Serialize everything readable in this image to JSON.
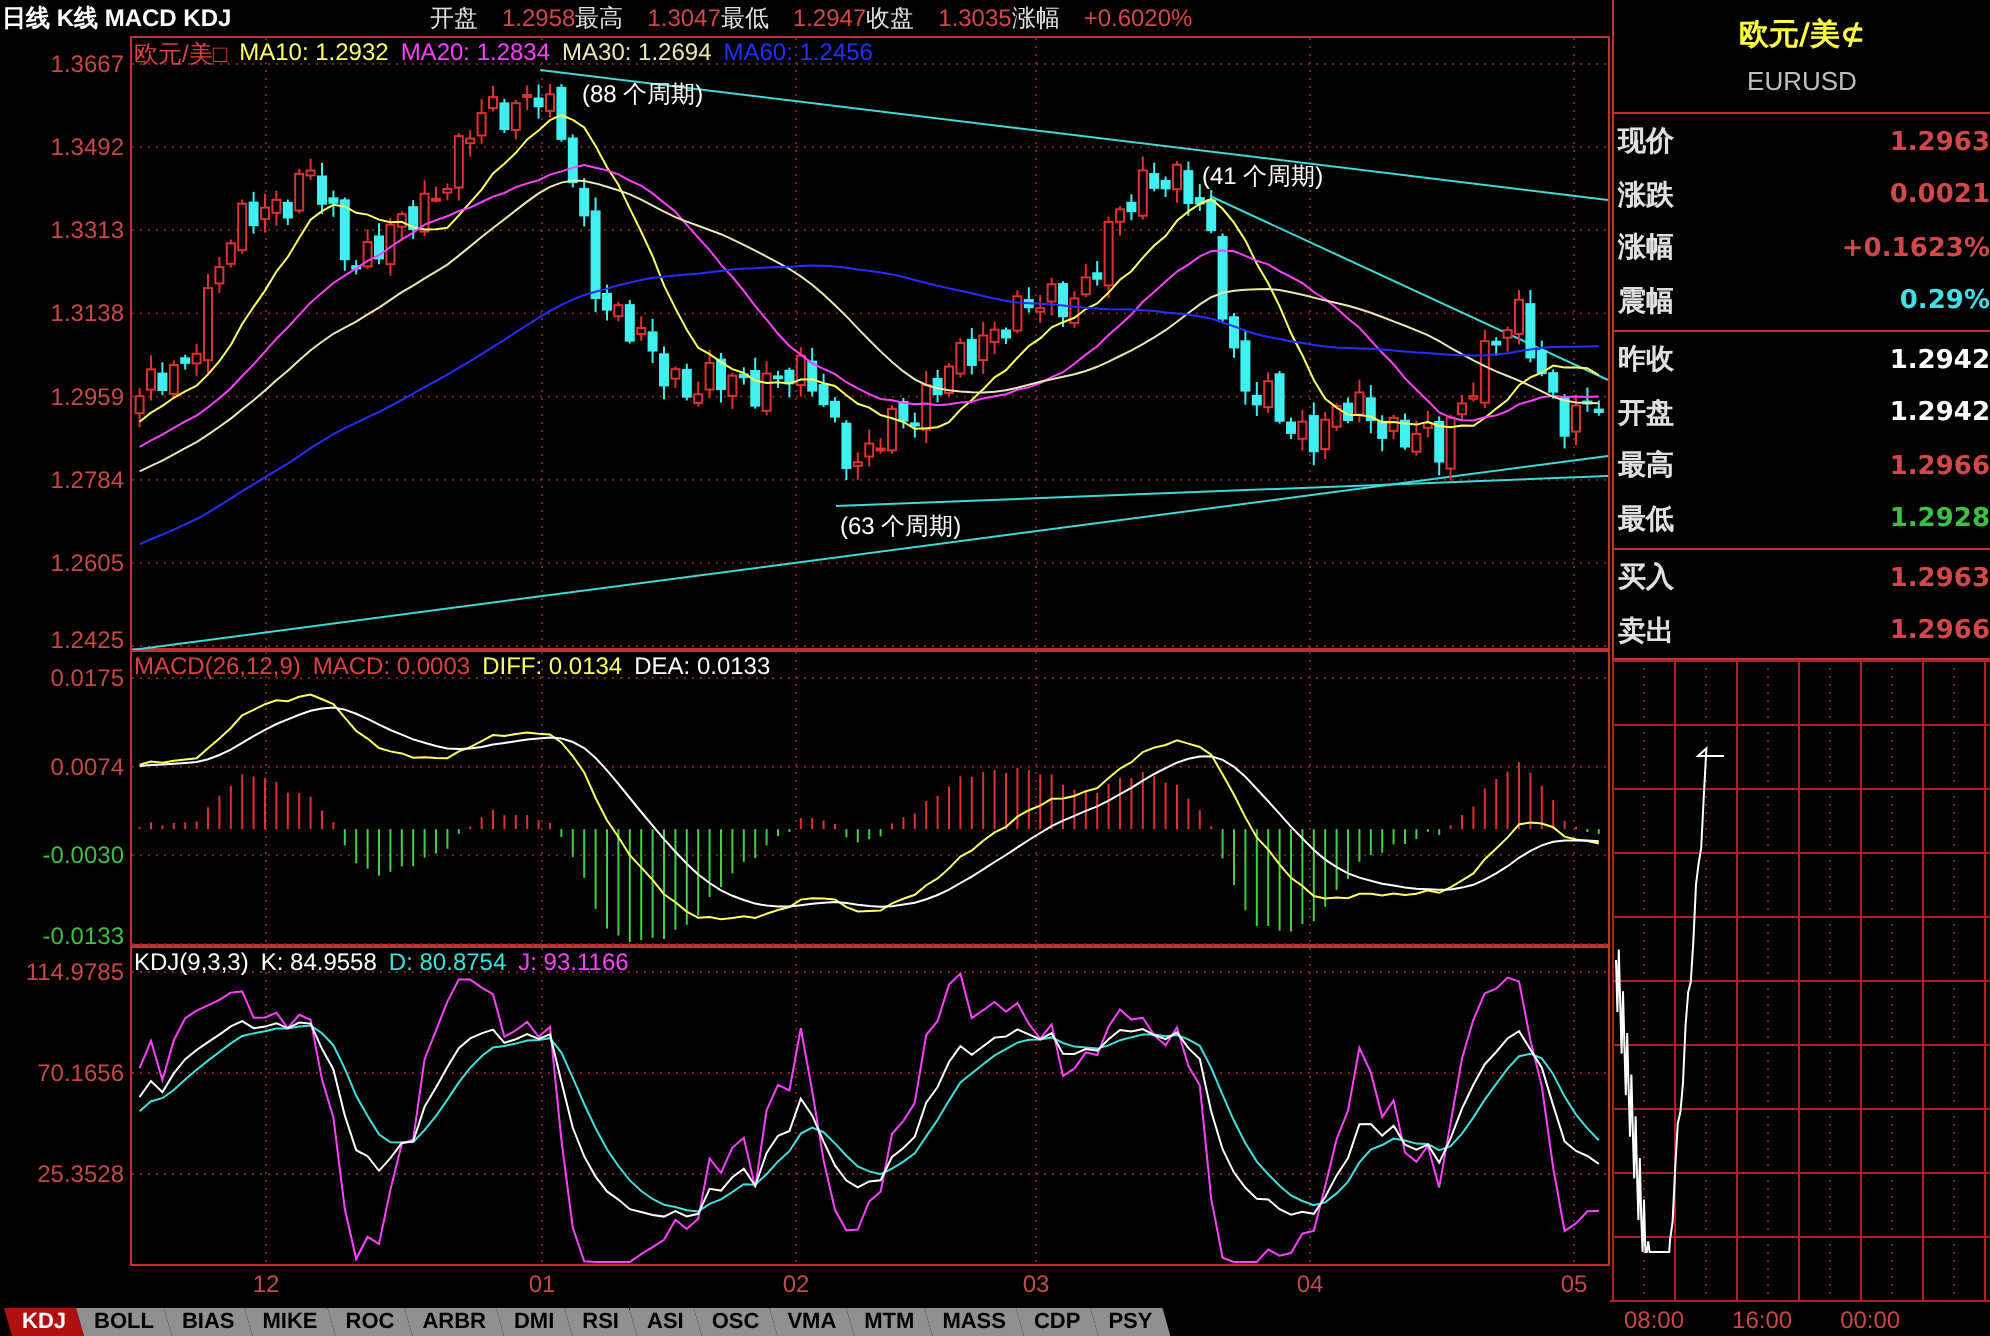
{
  "top_bar": {
    "title": "日线 K线 MACD KDJ",
    "quote": [
      {
        "label": "开盘",
        "value": "1.2958"
      },
      {
        "label": "最高",
        "value": "1.3047"
      },
      {
        "label": "最低",
        "value": "1.2947"
      },
      {
        "label": "收盘",
        "value": "1.3035"
      },
      {
        "label": "涨幅",
        "value": "+0.6020%"
      }
    ]
  },
  "price_pane": {
    "legend": [
      {
        "text": "欧元/美□",
        "color": "#e04040"
      },
      {
        "text": "MA10: 1.2932",
        "color": "#ffff60"
      },
      {
        "text": "MA20: 1.2834",
        "color": "#ff40ff"
      },
      {
        "text": "MA30: 1.2694",
        "color": "#e8e8b0"
      },
      {
        "text": "MA60: 1.2456",
        "color": "#2030ff"
      }
    ],
    "y_labels": [
      "1.3667",
      "1.3492",
      "1.3313",
      "1.3138",
      "1.2959",
      "1.2784",
      "1.2605",
      "1.2425"
    ],
    "annotations": [
      "(88 个周期)",
      "(41 个周期)",
      "(63 个周期)"
    ]
  },
  "macd_pane": {
    "legend": [
      {
        "text": "MACD(26,12,9)",
        "color": "#e04040"
      },
      {
        "text": "MACD: 0.0003",
        "color": "#e04040"
      },
      {
        "text": "DIFF: 0.0134",
        "color": "#ffff60"
      },
      {
        "text": "DEA: 0.0133",
        "color": "#ffffff"
      }
    ],
    "y_labels": [
      {
        "text": "0.0175",
        "color": "#c84848"
      },
      {
        "text": "0.0074",
        "color": "#c84848"
      },
      {
        "text": "-0.0030",
        "color": "#40c040"
      },
      {
        "text": "-0.0133",
        "color": "#40c040"
      }
    ]
  },
  "kdj_pane": {
    "legend": [
      {
        "text": "KDJ(9,3,3)",
        "color": "#ffffff"
      },
      {
        "text": "K: 84.9558",
        "color": "#ffffff"
      },
      {
        "text": "D: 80.8754",
        "color": "#40e0e0"
      },
      {
        "text": "J: 93.1166",
        "color": "#ff40ff"
      }
    ],
    "y_labels": [
      "114.9785",
      "70.1656",
      "25.3528"
    ]
  },
  "x_labels": [
    "12",
    "01",
    "02",
    "03",
    "04",
    "05"
  ],
  "tabs": [
    {
      "label": "KDJ",
      "selected": true
    },
    {
      "label": "BOLL",
      "selected": false
    },
    {
      "label": "BIAS",
      "selected": false
    },
    {
      "label": "MIKE",
      "selected": false
    },
    {
      "label": "ROC",
      "selected": false
    },
    {
      "label": "ARBR",
      "selected": false
    },
    {
      "label": "DMI",
      "selected": false
    },
    {
      "label": "RSI",
      "selected": false
    },
    {
      "label": "ASI",
      "selected": false
    },
    {
      "label": "OSC",
      "selected": false
    },
    {
      "label": "VMA",
      "selected": false
    },
    {
      "label": "MTM",
      "selected": false
    },
    {
      "label": "MASS",
      "selected": false
    },
    {
      "label": "CDP",
      "selected": false
    },
    {
      "label": "PSY",
      "selected": false
    }
  ],
  "info_panel": {
    "title": "欧元/美⊄",
    "symbol": "EURUSD",
    "groups": [
      [
        {
          "label": "现价",
          "value": "1.2963",
          "color": "#d04848"
        },
        {
          "label": "涨跌",
          "value": "0.0021",
          "color": "#d04848"
        },
        {
          "label": "涨幅",
          "value": "+0.1623%",
          "color": "#d04848"
        },
        {
          "label": "震幅",
          "value": "0.29%",
          "color": "#40e0e8"
        }
      ],
      [
        {
          "label": "昨收",
          "value": "1.2942",
          "color": "#ffffff"
        },
        {
          "label": "开盘",
          "value": "1.2942",
          "color": "#ffffff"
        },
        {
          "label": "最高",
          "value": "1.2966",
          "color": "#d04848"
        },
        {
          "label": "最低",
          "value": "1.2928",
          "color": "#40c040"
        }
      ],
      [
        {
          "label": "买入",
          "value": "1.2963",
          "color": "#d04848"
        },
        {
          "label": "卖出",
          "value": "1.2966",
          "color": "#d04848"
        }
      ]
    ]
  },
  "intraday": {
    "time_labels": [
      "08:00",
      "16:00",
      "00:00"
    ]
  }
}
